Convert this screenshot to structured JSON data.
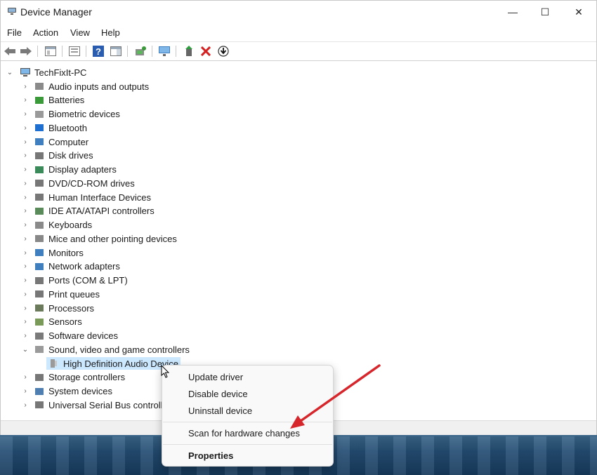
{
  "window": {
    "title": "Device Manager"
  },
  "titlebar_buttons": {
    "minimize": "—",
    "maximize": "☐",
    "close": "✕"
  },
  "menu": {
    "items": [
      "File",
      "Action",
      "View",
      "Help"
    ]
  },
  "toolbar": {
    "icons": [
      "back-icon",
      "forward-icon",
      "properties-pane-icon",
      "show-hide-console-tree-icon",
      "help-icon",
      "action-pane-icon",
      "scan-hardware-icon",
      "monitor-icon",
      "enable-device-icon",
      "uninstall-device-icon",
      "update-driver-icon"
    ]
  },
  "tree": {
    "root": "TechFixIt-PC",
    "categories": [
      "Audio inputs and outputs",
      "Batteries",
      "Biometric devices",
      "Bluetooth",
      "Computer",
      "Disk drives",
      "Display adapters",
      "DVD/CD-ROM drives",
      "Human Interface Devices",
      "IDE ATA/ATAPI controllers",
      "Keyboards",
      "Mice and other pointing devices",
      "Monitors",
      "Network adapters",
      "Ports (COM & LPT)",
      "Print queues",
      "Processors",
      "Sensors",
      "Software devices",
      "Sound, video and game controllers",
      "Storage controllers",
      "System devices",
      "Universal Serial Bus controlle"
    ],
    "expanded_child": "High Definition Audio Device"
  },
  "context_menu": {
    "items": [
      "Update driver",
      "Disable device",
      "Uninstall device",
      "Scan for hardware changes",
      "Properties"
    ]
  },
  "colors": {
    "annotation_arrow": "#d6262b",
    "selection": "#cce8ff"
  }
}
